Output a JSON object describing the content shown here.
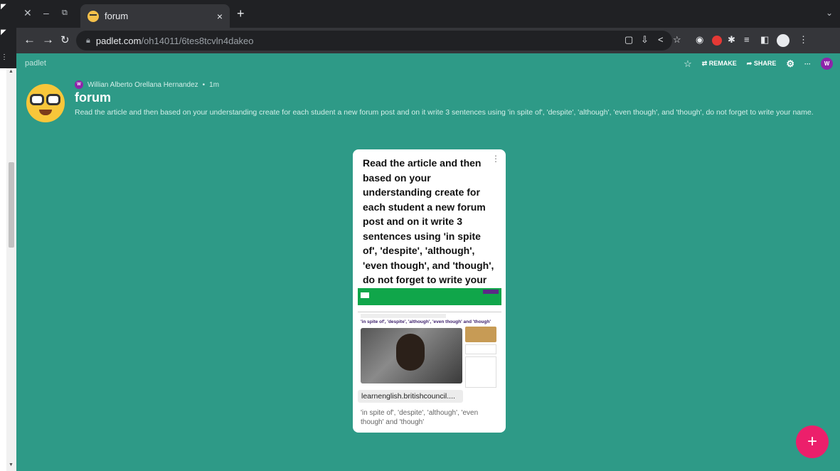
{
  "browser": {
    "tab_title": "forum",
    "url_host": "padlet.com",
    "url_path": "/oh14011/6tes8tcvln4dakeo"
  },
  "padlet": {
    "logo": "padlet",
    "remake_label": "REMAKE",
    "share_label": "SHARE",
    "more_label": "···",
    "user_initial": "W"
  },
  "post_header": {
    "author": "Willian Alberto Orellana Hernandez",
    "time": "1m",
    "title": "forum",
    "description": "Read the article and then based on your understanding create for each student a new forum post and on it write 3 sentences using 'in spite of', 'despite', 'although', 'even though', and 'though', do not forget to write your name."
  },
  "card": {
    "text": "Read the article and then based on your understanding create for each student a new forum post and on it write 3 sentences using 'in spite of', 'despite', 'although', 'even though', and 'though', do not forget to write your name.",
    "preview_title": "'in spite of', 'despite', 'although', 'even though' and 'though'",
    "link_domain": "learnenglish.britishcouncil....",
    "caption": "'in spite of', 'despite', 'although', 'even though' and 'though'"
  },
  "icons": {
    "fab": "+",
    "close": "×",
    "new_tab": "+"
  }
}
